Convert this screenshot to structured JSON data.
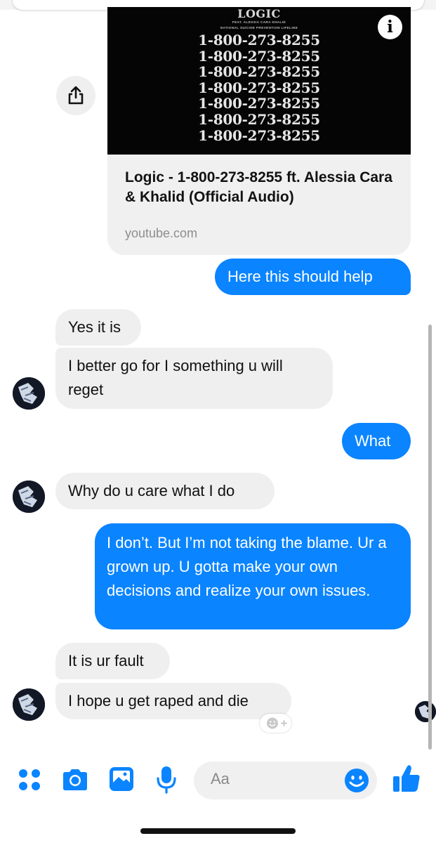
{
  "colors": {
    "outgoing_bubble": "#0a84ff",
    "incoming_bubble": "#efefef",
    "accent_icons": "#0a84ff",
    "link_domain": "#8e8e8e"
  },
  "shared_link": {
    "thumbnail": {
      "artist": "LOGIC",
      "feat_line": "FEAT. ALESSIA CARA  KHALID",
      "lifeline_line": "NATIONAL SUICIDE PREVENTION LIFELINE",
      "phone_lines": [
        "1-800-273-8255",
        "1-800-273-8255",
        "1-800-273-8255",
        "1-800-273-8255",
        "1-800-273-8255",
        "1-800-273-8255",
        "1-800-273-8255"
      ]
    },
    "title": "Logic - 1-800-273-8255 ft. Alessia Cara & Khalid (Official Audio)",
    "domain": "youtube.com",
    "share_icon": "share-icon",
    "info_icon": "info-icon"
  },
  "messages": [
    {
      "id": "m1",
      "direction": "out",
      "text": "Here this should help"
    },
    {
      "id": "m2",
      "direction": "in",
      "text": "Yes it is"
    },
    {
      "id": "m3",
      "direction": "in",
      "text": "I better go for I something u will reget"
    },
    {
      "id": "m4",
      "direction": "out",
      "text": "What"
    },
    {
      "id": "m5",
      "direction": "in",
      "text": "Why do u care what I do"
    },
    {
      "id": "m6",
      "direction": "out",
      "text": "I don’t. But I’m not taking the blame. Ur a grown up. U gotta make your own decisions and realize your own issues."
    },
    {
      "id": "m7",
      "direction": "in",
      "text": "It is ur fault"
    },
    {
      "id": "m8",
      "direction": "in",
      "text": "I hope u get raped and die"
    }
  ],
  "composer": {
    "placeholder": "Aa",
    "icons": [
      "apps-icon",
      "camera-icon",
      "image-icon",
      "microphone-icon",
      "emoji-icon",
      "thumbs-up-icon"
    ]
  }
}
